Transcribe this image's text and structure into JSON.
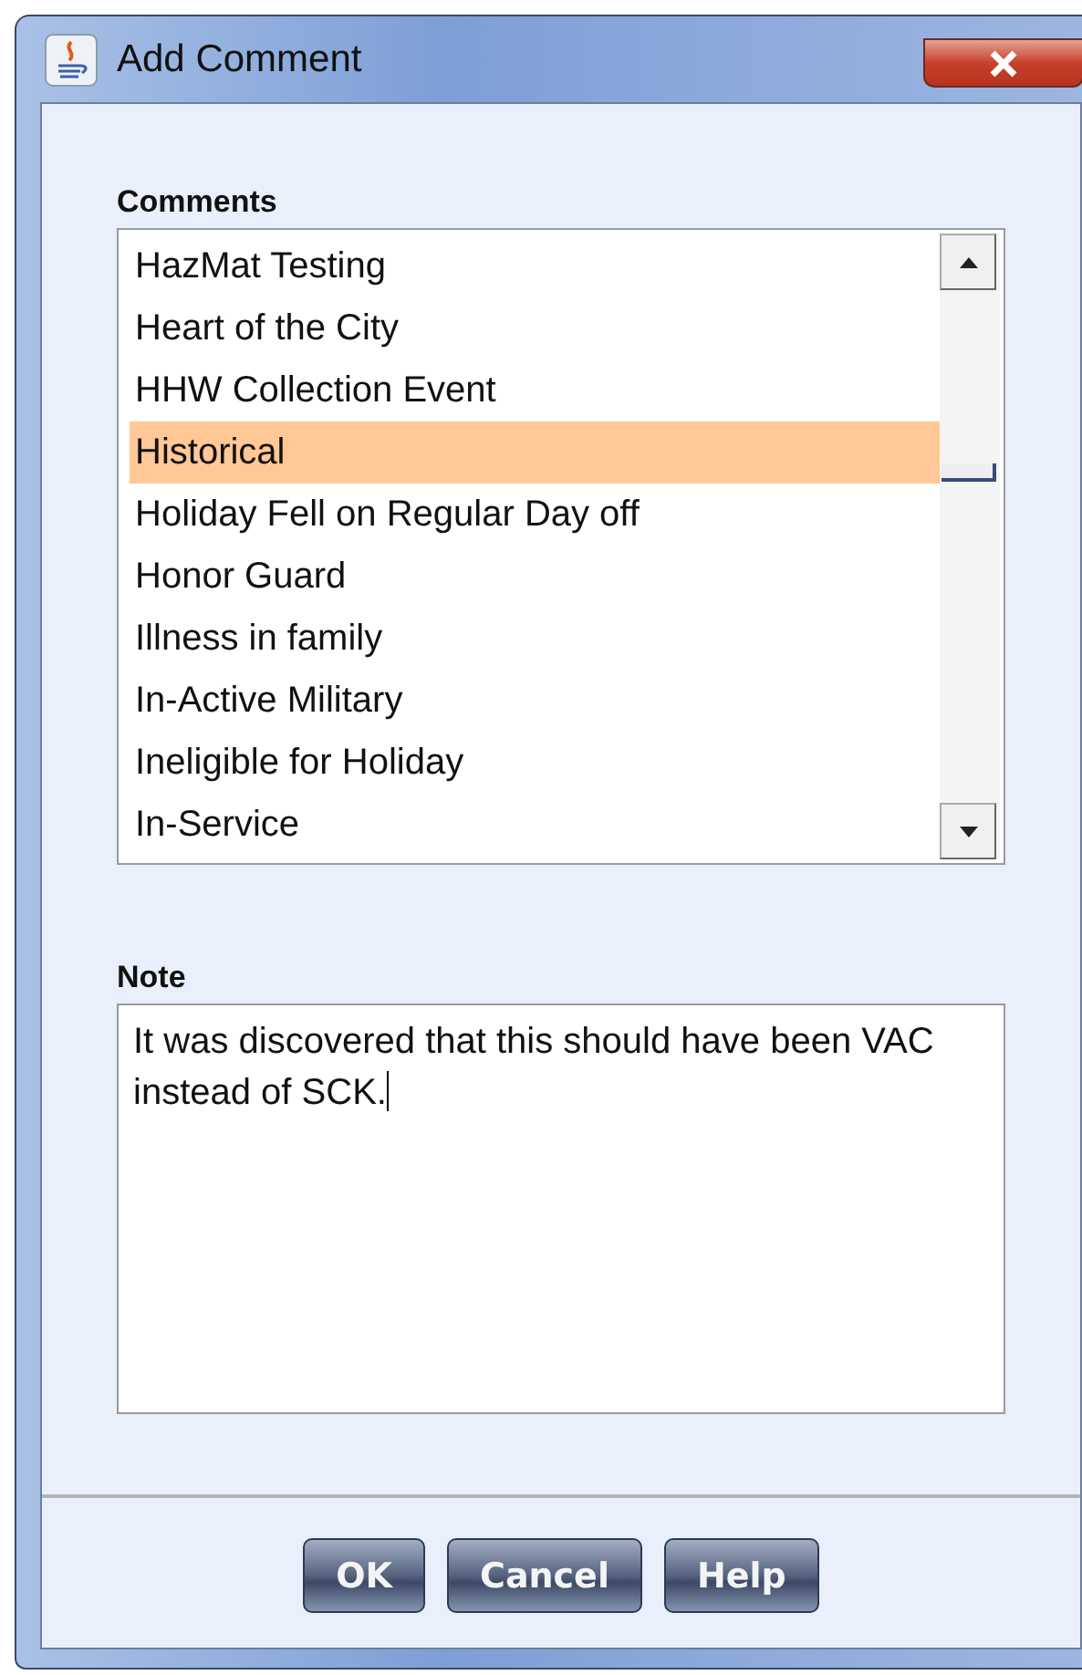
{
  "window": {
    "title": "Add Comment"
  },
  "comments": {
    "label": "Comments",
    "items": [
      {
        "label": "HazMat Testing",
        "selected": false
      },
      {
        "label": "Heart of the City",
        "selected": false
      },
      {
        "label": "HHW Collection Event",
        "selected": false
      },
      {
        "label": "Historical",
        "selected": true
      },
      {
        "label": "Holiday Fell on Regular Day off",
        "selected": false
      },
      {
        "label": "Honor Guard",
        "selected": false
      },
      {
        "label": "Illness in family",
        "selected": false
      },
      {
        "label": "In-Active Military",
        "selected": false
      },
      {
        "label": "Ineligible for Holiday",
        "selected": false
      },
      {
        "label": "In-Service",
        "selected": false
      }
    ]
  },
  "note": {
    "label": "Note",
    "value": "It was discovered that this should have been VAC instead of SCK."
  },
  "buttons": [
    "OK",
    "Cancel",
    "Help"
  ]
}
